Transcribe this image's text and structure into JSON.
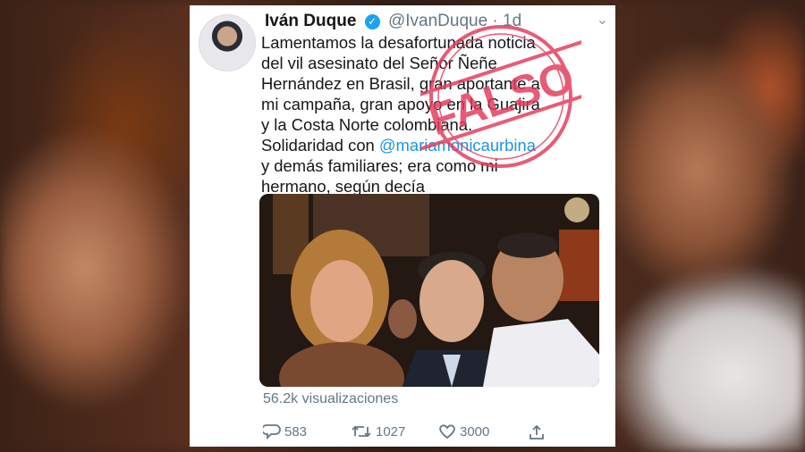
{
  "tweet": {
    "author_name": "Iván Duque",
    "author_handle": "@IvanDuque · 1d",
    "text_lines": [
      "Lamentamos la desafortunada noticia",
      "del vil asesinato del Señor Ñeñe",
      "Hernández en Brasil, gran aportante a",
      "mi campaña, gran apoyo en la Guajira",
      "y la Costa Norte colombiana.",
      "Solidaridad con ",
      "y demás familiares; era como mi",
      "hermano, según decía"
    ],
    "mention": "@mariamonicaurbina",
    "views": "56.2k visualizaciones",
    "replies": "583",
    "retweets": "1027",
    "likes": "3000"
  },
  "stamp": {
    "label": "FALSO",
    "color": "#e4385a"
  },
  "icons": {
    "verified": "verified-badge-icon",
    "menu": "chevron-down-icon",
    "reply": "reply-icon",
    "retweet": "retweet-icon",
    "like": "heart-icon",
    "share": "share-icon"
  }
}
